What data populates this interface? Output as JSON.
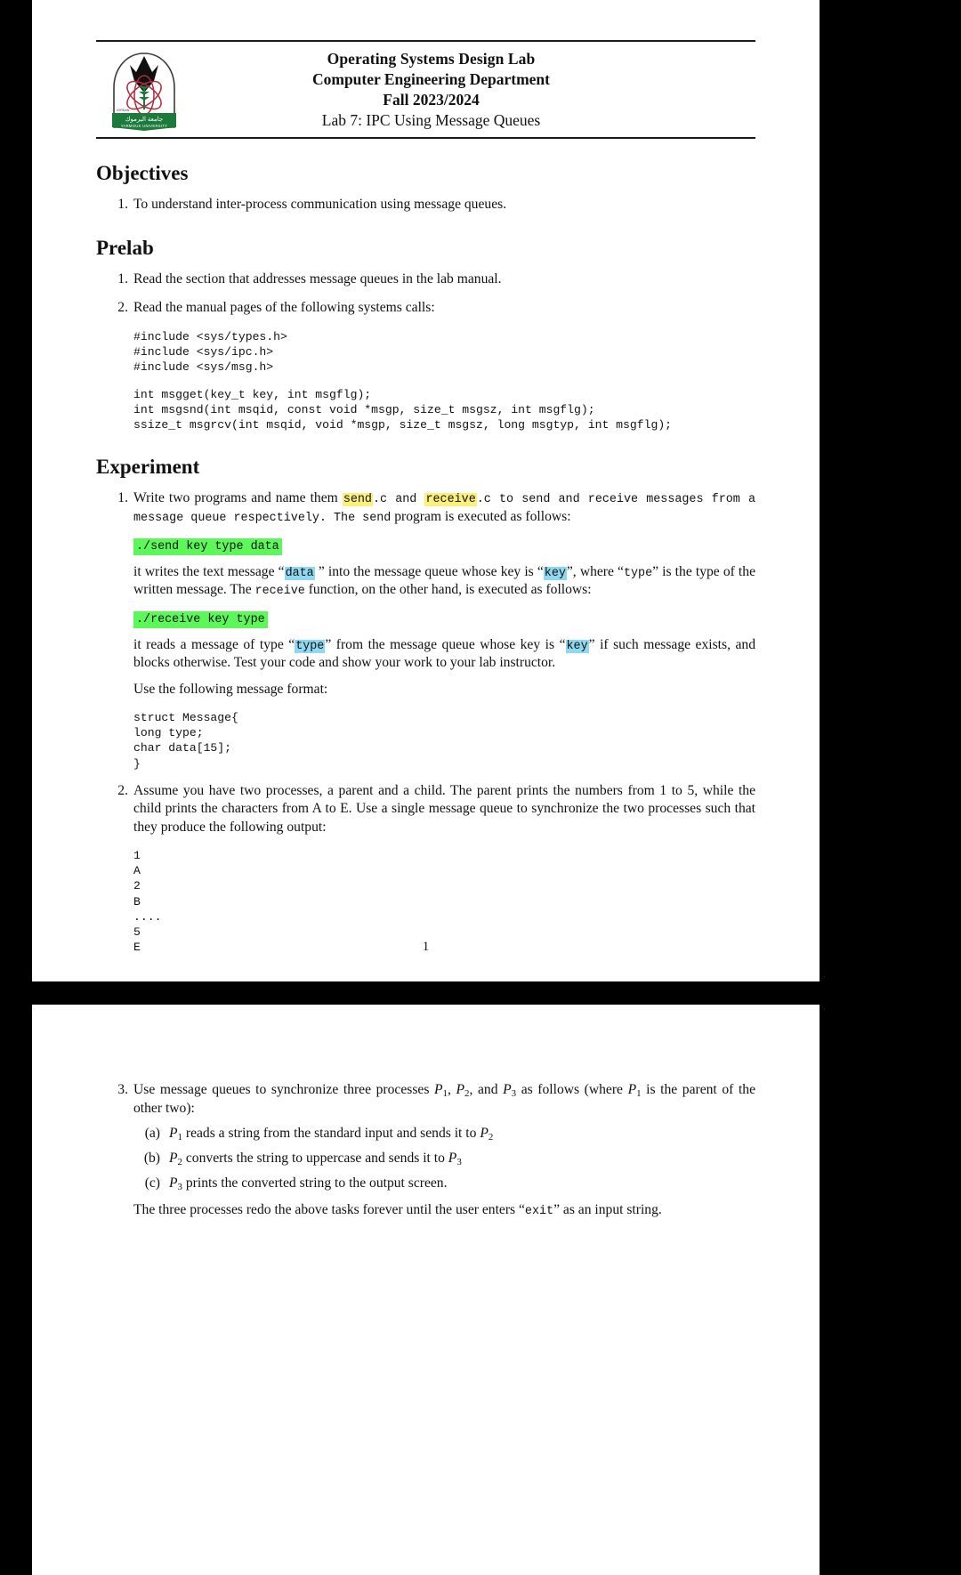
{
  "document": {
    "header": {
      "logo_alt": "Yarmouk University crest",
      "line1": "Operating Systems Design Lab",
      "line2": "Computer Engineering Department",
      "line3": "Fall 2023/2024",
      "line4": "Lab 7: IPC Using Message Queues"
    },
    "page1": {
      "page_number": "1",
      "sections": {
        "objectives": {
          "heading": "Objectives",
          "items": [
            {
              "num": "1.",
              "text": "To understand inter-process communication using message queues."
            }
          ]
        },
        "prelab": {
          "heading": "Prelab",
          "item1_num": "1.",
          "item1_text": "Read the section that addresses message queues in the lab manual.",
          "item2_num": "2.",
          "item2_text": "Read the manual pages of the following systems calls:",
          "code_includes": "#include <sys/types.h>\n#include <sys/ipc.h>\n#include <sys/msg.h>",
          "code_protos": "int msgget(key_t key, int msgflg);\nint msgsnd(int msqid, const void *msgp, size_t msgsz, int msgflg);\nssize_t msgrcv(int msqid, void *msgp, size_t msgsz, long msgtyp, int msgflg);"
        },
        "experiment": {
          "heading": "Experiment",
          "item1": {
            "num": "1.",
            "p1_a": "Write two programs and name them ",
            "p1_send": "send",
            "p1_b": ".c and ",
            "p1_receive": "receive",
            "p1_c": ".c to send and receive messages from a message queue respectively. The ",
            "p1_send2": "send",
            "p1_d": " program is executed as follows:",
            "cmd_send": "./send key type data",
            "p2_a": "it writes the text message “",
            "p2_data": "data",
            "p2_b": " ” into the message queue whose key is “",
            "p2_key": "key",
            "p2_c": "”, where “",
            "p2_type": "type",
            "p2_d": "” is the type of the written message. The ",
            "p2_receive": "receive",
            "p2_e": " function, on the other hand, is executed as follows:",
            "cmd_receive": "./receive key type",
            "p3_a": "it reads a message of type “",
            "p3_type": "type",
            "p3_b": "” from the message queue whose key is “",
            "p3_key": "key",
            "p3_c": "” if such message exists, and blocks otherwise. Test your code and show your work to your lab instructor.",
            "p4": "Use the following message format:",
            "code_struct": "struct Message{\nlong type;\nchar data[15];\n}"
          },
          "item2": {
            "num": "2.",
            "text": "Assume you have two processes, a parent and a child. The parent prints the numbers from 1 to 5, while the child prints the characters from A to E. Use a single message queue to synchronize the two processes such that they produce the following output:",
            "code_output": "1\nA\n2\nB\n....\n5\nE"
          }
        }
      }
    },
    "page2": {
      "item3": {
        "num": "3.",
        "a": "Use message queues to synchronize three processes ",
        "p1": "P",
        "p1sub": "1",
        "b": ", ",
        "p2": "P",
        "p2sub": "2",
        "c": ", and ",
        "p3": "P",
        "p3sub": "3",
        "d": " as follows (where ",
        "p1b": "P",
        "p1bsub": "1",
        "e": " is the parent of the other two):"
      },
      "sub_items": [
        {
          "num": "(a)",
          "a": "",
          "v1": "P",
          "v1sub": "1",
          "b": " reads a string from the standard input and sends it to ",
          "v2": "P",
          "v2sub": "2",
          "c": ""
        },
        {
          "num": "(b)",
          "a": "",
          "v1": "P",
          "v1sub": "2",
          "b": " converts the string to uppercase and sends it to ",
          "v2": "P",
          "v2sub": "3",
          "c": ""
        },
        {
          "num": "(c)",
          "a": "",
          "v1": "P",
          "v1sub": "3",
          "b": " prints the converted string to the output screen.",
          "v2": "",
          "v2sub": "",
          "c": ""
        }
      ],
      "closing": {
        "a": "The three processes redo the above tasks forever until the user enters “",
        "exit": "exit",
        "b": "” as an input string."
      }
    },
    "colors": {
      "highlight_yellow": "#fdf07a",
      "highlight_green": "#5cf758",
      "highlight_cyan": "#8fd8f2",
      "rule": "#1a1a1a",
      "page_background": "#ffffff",
      "canvas_background": "#000000"
    }
  }
}
